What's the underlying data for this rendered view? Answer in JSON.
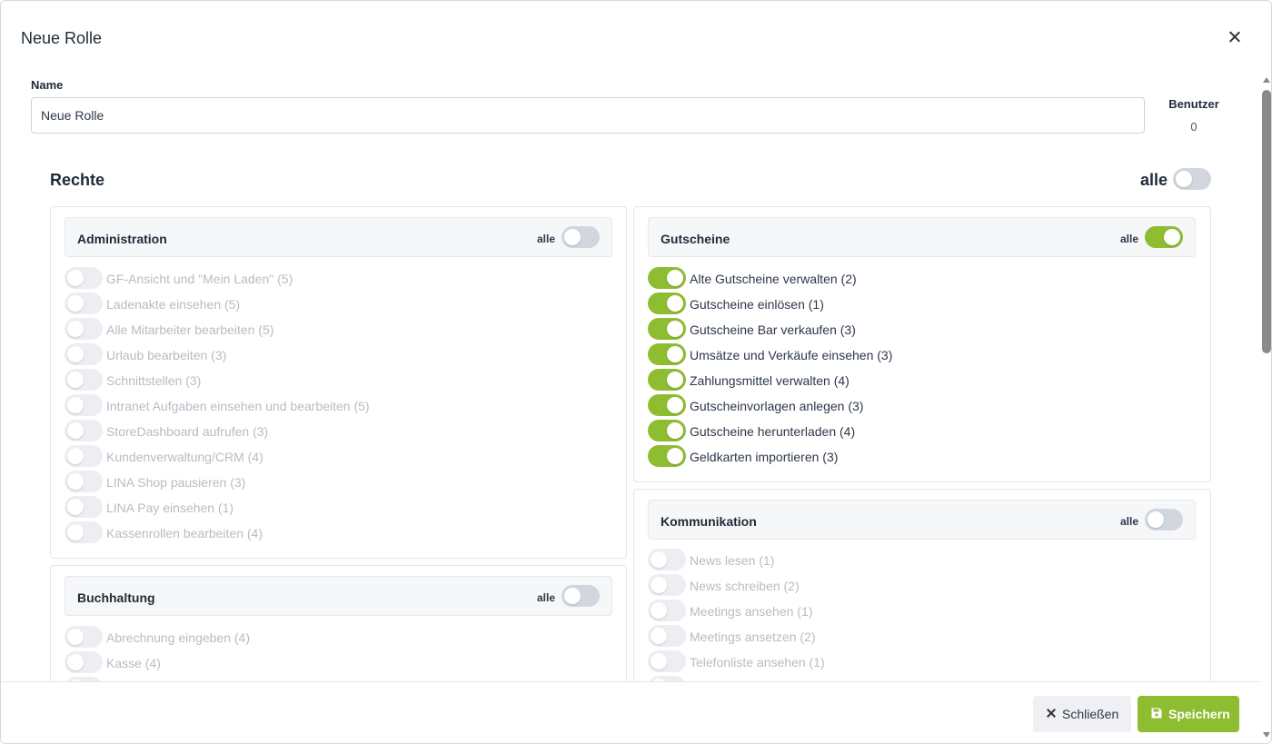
{
  "modal": {
    "title": "Neue Rolle"
  },
  "form": {
    "name_label": "Name",
    "name_value": "Neue Rolle",
    "users_label": "Benutzer",
    "users_count": "0"
  },
  "rights": {
    "title": "Rechte",
    "all_label": "alle",
    "all_on": false
  },
  "groups": {
    "administration": {
      "title": "Administration",
      "all_label": "alle",
      "all_on": false,
      "items": [
        {
          "label": "GF-Ansicht und \"Mein Laden\" (5)",
          "on": false
        },
        {
          "label": "Ladenakte einsehen (5)",
          "on": false
        },
        {
          "label": "Alle Mitarbeiter bearbeiten (5)",
          "on": false
        },
        {
          "label": "Urlaub bearbeiten (3)",
          "on": false
        },
        {
          "label": "Schnittstellen (3)",
          "on": false
        },
        {
          "label": "Intranet Aufgaben einsehen und bearbeiten (5)",
          "on": false
        },
        {
          "label": "StoreDashboard aufrufen (3)",
          "on": false
        },
        {
          "label": "Kundenverwaltung/CRM (4)",
          "on": false
        },
        {
          "label": "LINA Shop pausieren (3)",
          "on": false
        },
        {
          "label": "LINA Pay einsehen (1)",
          "on": false
        },
        {
          "label": "Kassenrollen bearbeiten (4)",
          "on": false
        }
      ]
    },
    "buchhaltung": {
      "title": "Buchhaltung",
      "all_label": "alle",
      "all_on": false,
      "items": [
        {
          "label": "Abrechnung eingeben (4)",
          "on": false
        },
        {
          "label": "Kasse (4)",
          "on": false
        }
      ]
    },
    "gutscheine": {
      "title": "Gutscheine",
      "all_label": "alle",
      "all_on": true,
      "items": [
        {
          "label": "Alte Gutscheine verwalten (2)",
          "on": true
        },
        {
          "label": "Gutscheine einlösen (1)",
          "on": true
        },
        {
          "label": "Gutscheine Bar verkaufen (3)",
          "on": true
        },
        {
          "label": "Umsätze und Verkäufe einsehen (3)",
          "on": true
        },
        {
          "label": "Zahlungsmittel verwalten (4)",
          "on": true
        },
        {
          "label": "Gutscheinvorlagen anlegen (3)",
          "on": true
        },
        {
          "label": "Gutscheine herunterladen (4)",
          "on": true
        },
        {
          "label": "Geldkarten importieren (3)",
          "on": true
        }
      ]
    },
    "kommunikation": {
      "title": "Kommunikation",
      "all_label": "alle",
      "all_on": false,
      "items": [
        {
          "label": "News lesen (1)",
          "on": false
        },
        {
          "label": "News schreiben (2)",
          "on": false
        },
        {
          "label": "Meetings ansehen (1)",
          "on": false
        },
        {
          "label": "Meetings ansetzen (2)",
          "on": false
        },
        {
          "label": "Telefonliste ansehen (1)",
          "on": false
        }
      ]
    }
  },
  "footer": {
    "close_label": "Schließen",
    "save_label": "Speichern"
  },
  "colors": {
    "accent": "#8ebd31",
    "toggle_off": "#d2d7df",
    "disabled_text": "#b7bcc4"
  },
  "icons": {
    "close": "close-icon",
    "save": "floppy-disk-icon"
  }
}
